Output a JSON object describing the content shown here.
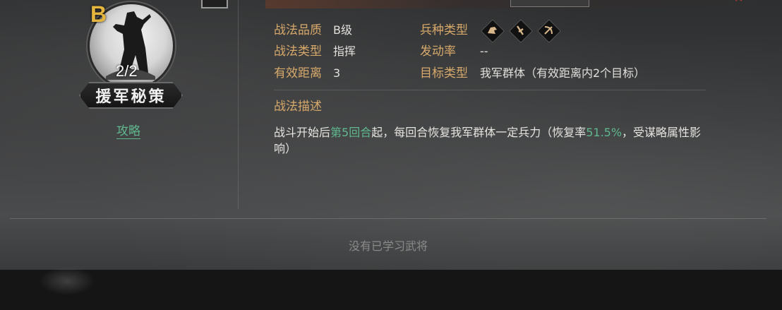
{
  "skill": {
    "grade": "B",
    "count": "2/2",
    "name": "援军秘策",
    "guide_link": "攻略"
  },
  "info": {
    "quality_label": "战法品质",
    "quality_value": "B级",
    "type_label": "战法类型",
    "type_value": "指挥",
    "range_label": "有效距离",
    "range_value": "3",
    "troop_label": "兵种类型",
    "rate_label": "发动率",
    "rate_value": "--",
    "target_label": "目标类型",
    "target_value": "我军群体（有效距离内2个目标）",
    "troop_icons": [
      "cavalry-icon",
      "shield-icon",
      "bow-icon"
    ]
  },
  "description": {
    "heading": "战法描述",
    "part1": "战斗开始后",
    "hl1": "第5回合",
    "part2": "起，每回合恢复我军群体一定兵力（恢复率",
    "hl2": "51.5%",
    "part3": "，受谋略属性影响）"
  },
  "footer": {
    "empty_note": "没有已学习武将"
  },
  "colors": {
    "label": "#d7a96b",
    "highlight": "#5fb88f",
    "grade": "#e4b640"
  }
}
